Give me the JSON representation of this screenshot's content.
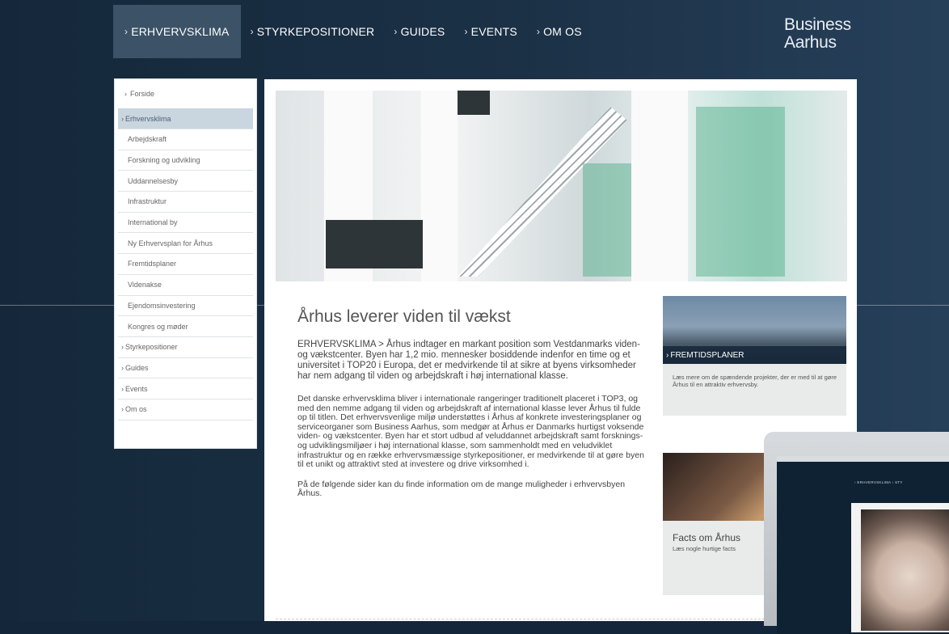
{
  "nav": {
    "items": [
      {
        "label": "ERHVERVSKLIMA",
        "active": true
      },
      {
        "label": "STYRKEPOSITIONER",
        "active": false
      },
      {
        "label": "GUIDES",
        "active": false
      },
      {
        "label": "EVENTS",
        "active": false
      },
      {
        "label": "OM OS",
        "active": false
      }
    ]
  },
  "logo": {
    "line1": "Business",
    "line2": "Aarhus"
  },
  "sidebar": {
    "front": "Forside",
    "section": "Erhvervsklima",
    "sub_items": [
      "Arbejdskraft",
      "Forskning og udvikling",
      "Uddannelsesby",
      "Infrastruktur",
      "International by",
      "Ny Erhvervsplan for Århus",
      "Fremtidsplaner",
      "Videnakse",
      "Ejendomsinvestering",
      "Kongres og møder"
    ],
    "main_items": [
      "Styrkepositioner",
      "Guides",
      "Events",
      "Om os"
    ]
  },
  "article": {
    "title": "Århus leverer viden til vækst",
    "lead": "ERHVERVSKLIMA > Århus indtager en markant position som Vestdanmarks viden- og vækstcenter. Byen har 1,2 mio. mennesker bosiddende indenfor en time og et universitet i TOP20 i Europa, det er medvirkende til at sikre at byens virksomheder har nem adgang til viden og arbejdskraft i høj international klasse.",
    "body1": "Det danske erhvervsklima bliver i internationale rangeringer traditionelt placeret i TOP3, og med den nemme adgang til viden og arbejdskraft af international klasse lever Århus til fulde op til titlen. Det erhvervsvenlige miljø understøttes i Århus af konkrete investeringsplaner og serviceorganer som Business Aarhus, som medgør at Århus er Danmarks hurtigst voksende viden- og vækstcenter. Byen har et stort udbud af veluddannet arbejdskraft samt forsknings- og udviklingsmiljøer i høj international klasse, som sammenholdt med en veludviklet infrastruktur og en række erhvervsmæssige styrkepositioner, er medvirkende til at gøre byen til et unikt og attraktivt sted at investere og drive virksomhed i.",
    "body2": "På de følgende sider kan du finde information om de mange muligheder i erhvervsbyen Århus."
  },
  "teaser1": {
    "title": "FREMTIDSPLANER",
    "text": "Læs mere om de spændende projekter, der er med til at gøre Århus til en attraktiv erhvervsby."
  },
  "teaser2": {
    "title": "Facts om Århus",
    "text": "Læs nogle hurtige facts"
  },
  "laptop": {
    "nav_text": "› ERHVERVSKLIMA   › STY"
  }
}
